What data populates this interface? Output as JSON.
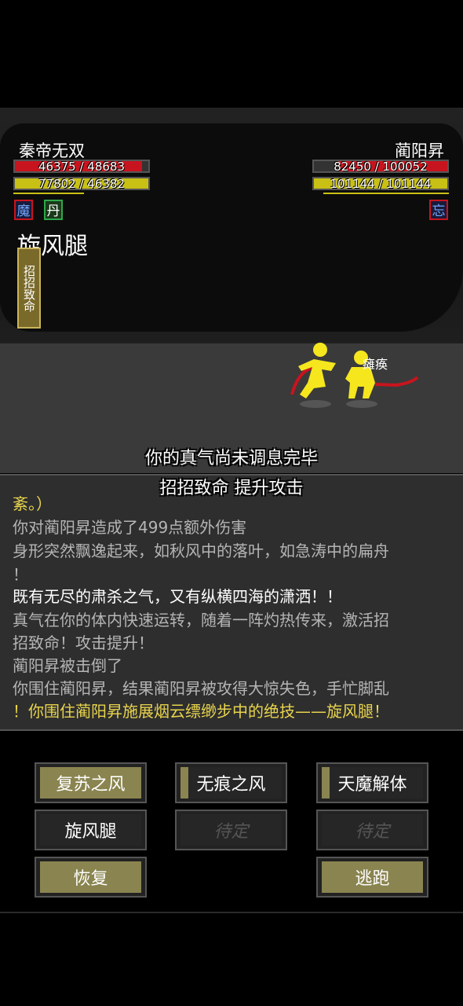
{
  "player": {
    "name": "秦帝无双",
    "hp": "46375 / 48683",
    "hp_fraction": 0.95,
    "mp": "77802 / 46382",
    "mp_fraction": 1.0,
    "badges": [
      "魔",
      "丹"
    ],
    "skill": "旋风腿",
    "tag": "招招致命"
  },
  "enemy": {
    "name": "蔺阳昇",
    "hp": "82450 / 100052",
    "hp_fraction": 0.82,
    "mp": "101144 / 101144",
    "mp_fraction": 1.0,
    "badge": "忘",
    "status": "瘫痪"
  },
  "center_messages": [
    "你的真气尚未调息完毕",
    "招招致命 提升攻击"
  ],
  "log": [
    {
      "text": "紊。）",
      "color": "#e8d44d"
    },
    {
      "text": "你对蔺阳昇造成了499点额外伤害",
      "color": "#b5b5b5"
    },
    {
      "text": "身形突然飘逸起来，如秋风中的落叶，如急涛中的扁舟",
      "color": "#b5b5b5"
    },
    {
      "text": "！",
      "color": "#b5b5b5"
    },
    {
      "text": "既有无尽的肃杀之气，又有纵横四海的潇洒！！",
      "color": "#ffffff"
    },
    {
      "text": "真气在你的体内快速运转，随着一阵灼热传来，激活招",
      "color": "#b5b5b5"
    },
    {
      "text": "招致命！攻击提升！",
      "color": "#b5b5b5"
    },
    {
      "text": "蔺阳昇被击倒了",
      "color": "#b5b5b5"
    },
    {
      "text": "你围住蔺阳昇，结果蔺阳昇被攻得大惊失色，手忙脚乱",
      "color": "#b5b5b5"
    },
    {
      "text": "！你围住蔺阳昇施展烟云缥缈步中的绝技——旋风腿！",
      "color": "#e8d44d"
    }
  ],
  "buttons": {
    "revive": "复苏之风",
    "traceless": "无痕之风",
    "demon": "天魔解体",
    "whirlwind": "旋风腿",
    "pending1": "待定",
    "pending2": "待定",
    "recover": "恢复",
    "flee": "逃跑"
  },
  "colors": {
    "hp": "#c8141e",
    "mp": "#c8c014",
    "gold": "#8a8450"
  }
}
